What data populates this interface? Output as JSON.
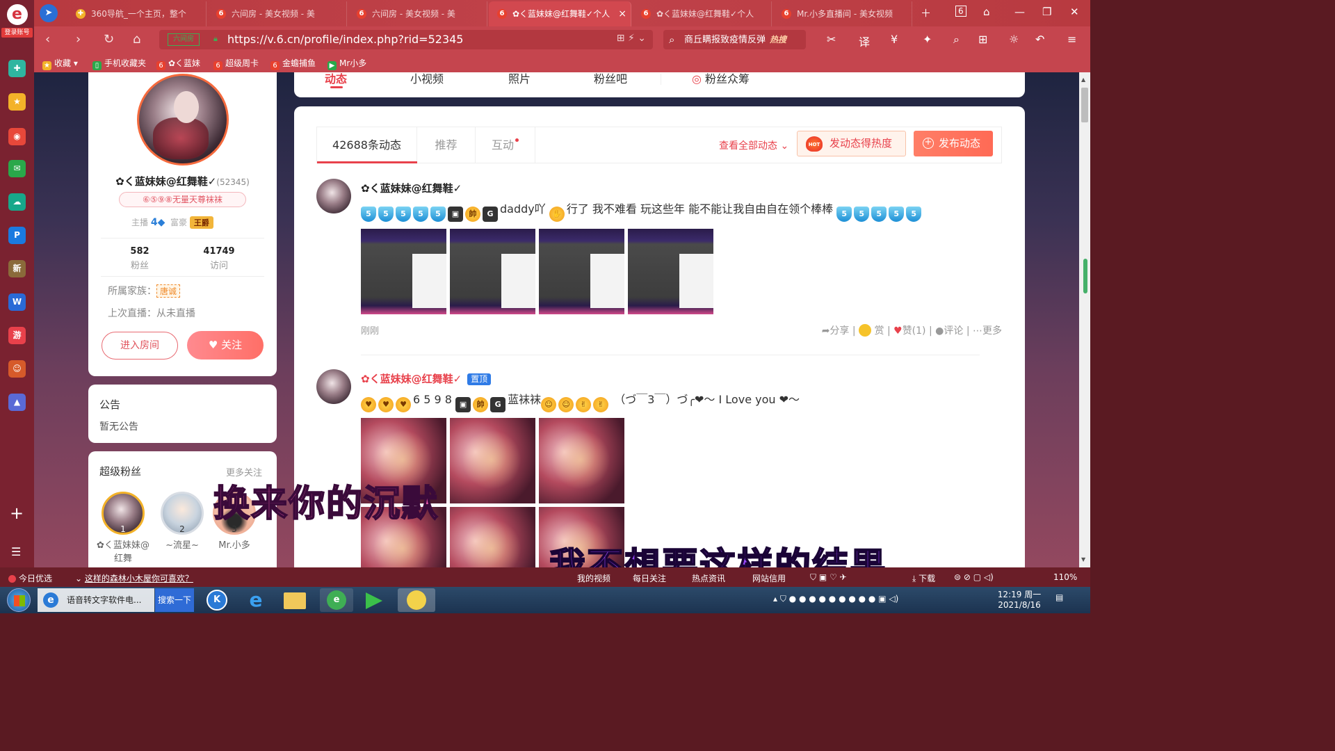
{
  "rail": {
    "login_label": "登录账号",
    "icons": [
      {
        "name": "compass-icon",
        "color": "#2fb5a0",
        "glyph": "✚"
      },
      {
        "name": "star-icon",
        "color": "#f3b229",
        "glyph": "★"
      },
      {
        "name": "weibo-icon",
        "color": "#e8483a",
        "glyph": "◉"
      },
      {
        "name": "mail-icon",
        "color": "#2aa84a",
        "glyph": "✉"
      },
      {
        "name": "cloud-icon",
        "color": "#17a88a",
        "glyph": "☁"
      },
      {
        "name": "pay-icon",
        "color": "#1a7ae0",
        "glyph": "P"
      },
      {
        "name": "news-icon",
        "color": "#8a6a3a",
        "glyph": "新"
      },
      {
        "name": "doc-icon",
        "color": "#2a6ad6",
        "glyph": "W"
      },
      {
        "name": "game-icon",
        "color": "#e8414b",
        "glyph": "游"
      },
      {
        "name": "game2-icon",
        "color": "#d65a2a",
        "glyph": "☺"
      },
      {
        "name": "game3-icon",
        "color": "#5a6ad6",
        "glyph": "▲"
      }
    ]
  },
  "tabs": [
    {
      "label": "360导航_一个主页，整个",
      "fav": "✚"
    },
    {
      "label": "六间房 - 美女视频 - 美",
      "fav": "6"
    },
    {
      "label": "六间房 - 美女视频 - 美",
      "fav": "6"
    },
    {
      "label": "✿く蓝妹妹@红舞鞋✓个人",
      "fav": "6"
    },
    {
      "label": "✿く蓝妹妹@红舞鞋✓个人",
      "fav": "6"
    },
    {
      "label": "Mr.小多直播间 - 美女视频",
      "fav": "6"
    }
  ],
  "address": {
    "badge": "六间房",
    "url": "https://v.6.cn/profile/index.php?rid=52345",
    "search_text": "商丘瞒报致疫情反弹",
    "search_hot": "热搜"
  },
  "bookmarks": [
    {
      "label": "收藏",
      "color": "#f3b229"
    },
    {
      "label": "手机收藏夹",
      "color": "#2aa84a"
    },
    {
      "label": "✿く蓝妹",
      "color": "#e8402e"
    },
    {
      "label": "超级周卡",
      "color": "#e8402e"
    },
    {
      "label": "金蟾捕鱼",
      "color": "#e8402e"
    },
    {
      "label": "Mr小多",
      "color": "#2aa84a"
    }
  ],
  "profile": {
    "name": "✿く蓝妹妹@红舞鞋✓",
    "rid": "(52345)",
    "title": "⑥⑤⑨⑧无量天尊袜袜",
    "anchor_label": "主播",
    "anchor_level": "4",
    "rich_label": "富豪",
    "rich_level": "王爵",
    "fans_count": "582",
    "fans_label": "粉丝",
    "visits_count": "41749",
    "visits_label": "访问",
    "family_label": "所属家族：",
    "family_value": "唐诚",
    "last_live": "上次直播：从未直播",
    "enter_room": "进入房间",
    "follow": "关注"
  },
  "notice": {
    "title": "公告",
    "body": "暂无公告"
  },
  "super_fans": {
    "title": "超级粉丝",
    "more": "更多关注",
    "fans": [
      {
        "rank": "1",
        "name": "✿く蓝妹妹@红舞",
        "color": "#f3b229"
      },
      {
        "rank": "2",
        "name": "~流星~",
        "color": "#d8dde4"
      },
      {
        "rank": "3",
        "name": "Mr.小多",
        "color": "#f0b29a"
      }
    ]
  },
  "top_nav": {
    "items": [
      "动态",
      "小视频",
      "照片",
      "粉丝吧",
      "粉丝众筹"
    ]
  },
  "feed": {
    "tabs": [
      "42688条动态",
      "推荐",
      "互动"
    ],
    "view_all": "查看全部动态",
    "heat_button": "发动态得热度",
    "heat_badge": "HOT",
    "post_button": "发布动态"
  },
  "posts": [
    {
      "name": "✿く蓝妹妹@红舞鞋✓",
      "pinned": false,
      "text_pre": "",
      "text_mid": "daddy吖",
      "text_post": "行了 我不难看 玩这些年 能不能让我自由自在领个棒棒",
      "time": "刚刚",
      "share": "分享",
      "reward": "赏",
      "like": "赞(1)",
      "comment": "评论",
      "more": "更多"
    },
    {
      "name": "✿く蓝妹妹@红舞鞋✓",
      "pinned": true,
      "pin_label": "置顶",
      "text_pre": "6 5 9 8",
      "text_mid": "蓝袜袜",
      "text_post": "（づ￣3￣）づ╭❤～ I Love you ❤～"
    }
  ],
  "subtitles": {
    "line1": "换来你的沉默",
    "line2": "我不想要这样的结果"
  },
  "statusbar": {
    "left": "今日优选",
    "headline": "这样的森林小木屋你可喜欢？",
    "items": [
      "我的视频",
      "每日关注",
      "热点资讯",
      "网站信用",
      "下载"
    ],
    "zoom": "110%"
  },
  "taskbar": {
    "active_app": "语音转文字软件电...",
    "search": "搜索一下",
    "time": "12:19 周一",
    "date": "2021/8/16"
  }
}
